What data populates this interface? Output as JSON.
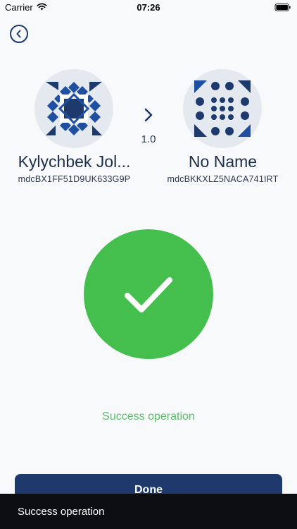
{
  "status_bar": {
    "carrier": "Carrier",
    "time": "07:26"
  },
  "transfer": {
    "sender": {
      "name": "Kylychbek Jol...",
      "address": "mdcBX1FF51D9UK633G9P"
    },
    "receiver": {
      "name": "No Name",
      "address": "mdcBKKXLZ5NACA741IRT"
    },
    "amount": "1.0"
  },
  "result": {
    "message": "Success operation"
  },
  "actions": {
    "done_label": "Done"
  },
  "toast": {
    "message": "Success operation"
  },
  "colors": {
    "accent": "#1e3a6c",
    "success": "#44bf4e",
    "success_text": "#5cbc6a",
    "background": "#f7f9fb"
  },
  "icons": {
    "back": "chevron-left-circle-icon",
    "arrow": "chevron-right-icon",
    "success": "checkmark-icon"
  }
}
